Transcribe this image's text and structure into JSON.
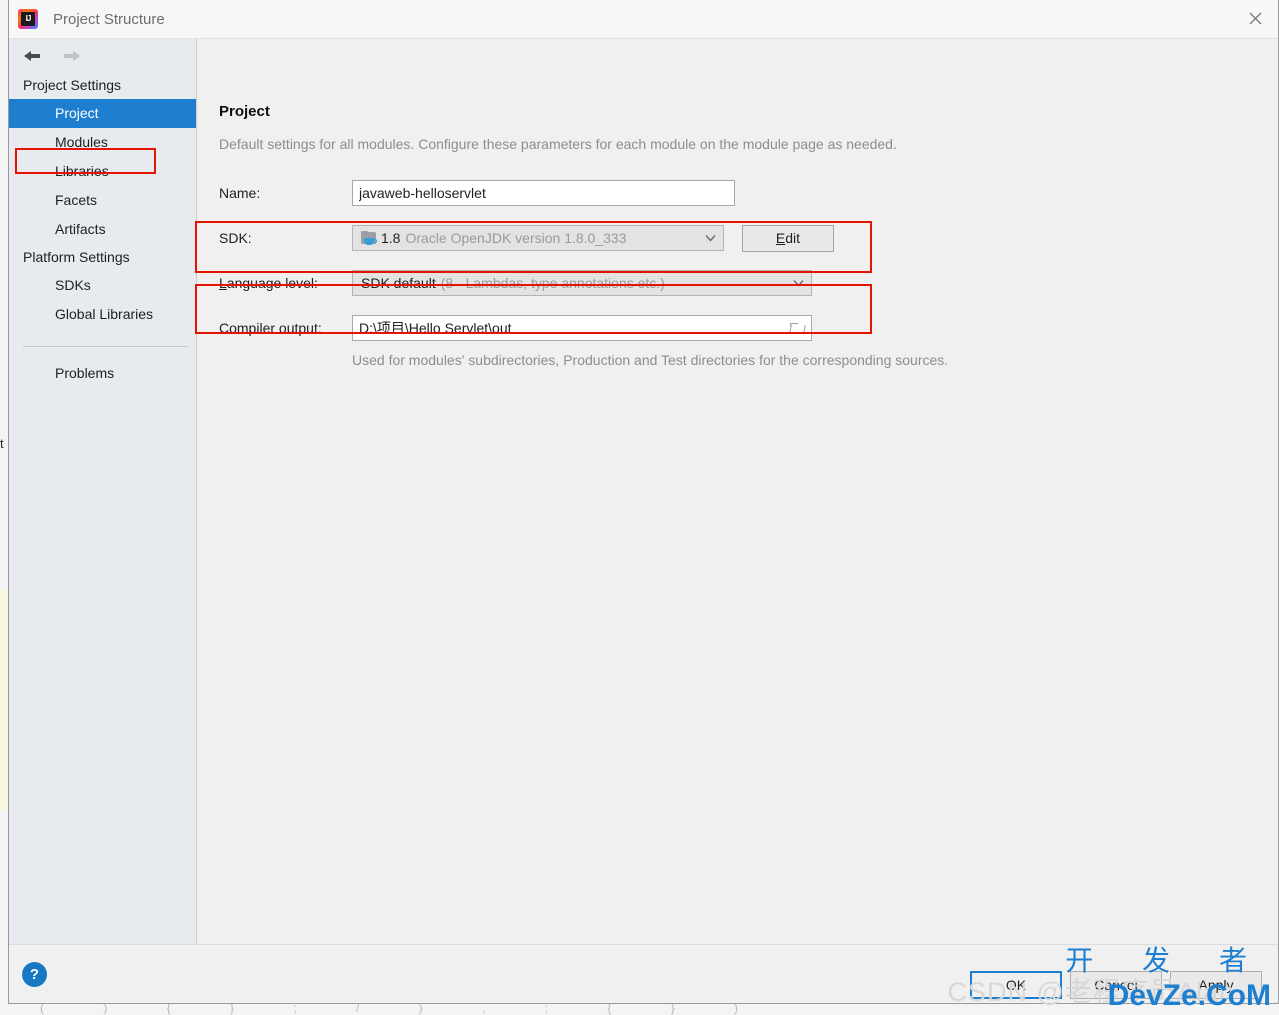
{
  "window": {
    "title": "Project Structure",
    "app_icon": "intellij-idea-icon",
    "close_icon": "close-icon"
  },
  "nav": {
    "back_icon": "arrow-left-icon",
    "forward_icon": "arrow-right-icon"
  },
  "sidebar": {
    "groups": [
      {
        "label": "Project Settings",
        "items": [
          {
            "label": "Project",
            "selected": true
          },
          {
            "label": "Modules",
            "selected": false
          },
          {
            "label": "Libraries",
            "selected": false
          },
          {
            "label": "Facets",
            "selected": false
          },
          {
            "label": "Artifacts",
            "selected": false
          }
        ]
      },
      {
        "label": "Platform Settings",
        "items": [
          {
            "label": "SDKs",
            "selected": false
          },
          {
            "label": "Global Libraries",
            "selected": false
          }
        ]
      }
    ],
    "problems_label": "Problems"
  },
  "main": {
    "title": "Project",
    "description": "Default settings for all modules. Configure these parameters for each module on the module page as needed.",
    "name": {
      "label": "Name:",
      "value": "javaweb-helloservlet",
      "placeholder": ""
    },
    "sdk": {
      "label": "SDK:",
      "icon": "jdk-icon",
      "value": "1.8",
      "detail": "Oracle OpenJDK version 1.8.0_333",
      "dropdown_icon": "chevron-down-icon",
      "edit_button": "Edit",
      "edit_button_mnemonic": "E"
    },
    "language_level": {
      "label": "Language level:",
      "label_mnemonic": "L",
      "value": "SDK default",
      "detail": "(8 - Lambdas, type annotations etc.)",
      "dropdown_icon": "chevron-down-icon"
    },
    "compiler_output": {
      "label": "Compiler output:",
      "value": "D:\\项目\\Hello Servlet\\out",
      "placeholder": "",
      "browse_icon": "folder-browse-icon",
      "hint": "Used for modules' subdirectories, Production and Test directories for the corresponding sources."
    }
  },
  "footer": {
    "help_icon": "?",
    "buttons": [
      {
        "label": "OK",
        "default": true
      },
      {
        "label": "Cancel",
        "default": false
      },
      {
        "label": "Apply",
        "default": false
      }
    ]
  },
  "watermarks": {
    "csdn": "CSDN @老程序员Alan",
    "chinese": "开 发 者",
    "english": "DevZe.CoM"
  },
  "annotations": {
    "color": "#e51400",
    "boxes": [
      "project-sidebar-item",
      "sdk-row",
      "language-level-row"
    ]
  },
  "colors": {
    "accent": "#1e7fd0",
    "selection": "#1e7fd0",
    "annotation": "#e51400",
    "sidebar_bg": "#e7ebef",
    "content_bg": "#f0f0f0"
  }
}
